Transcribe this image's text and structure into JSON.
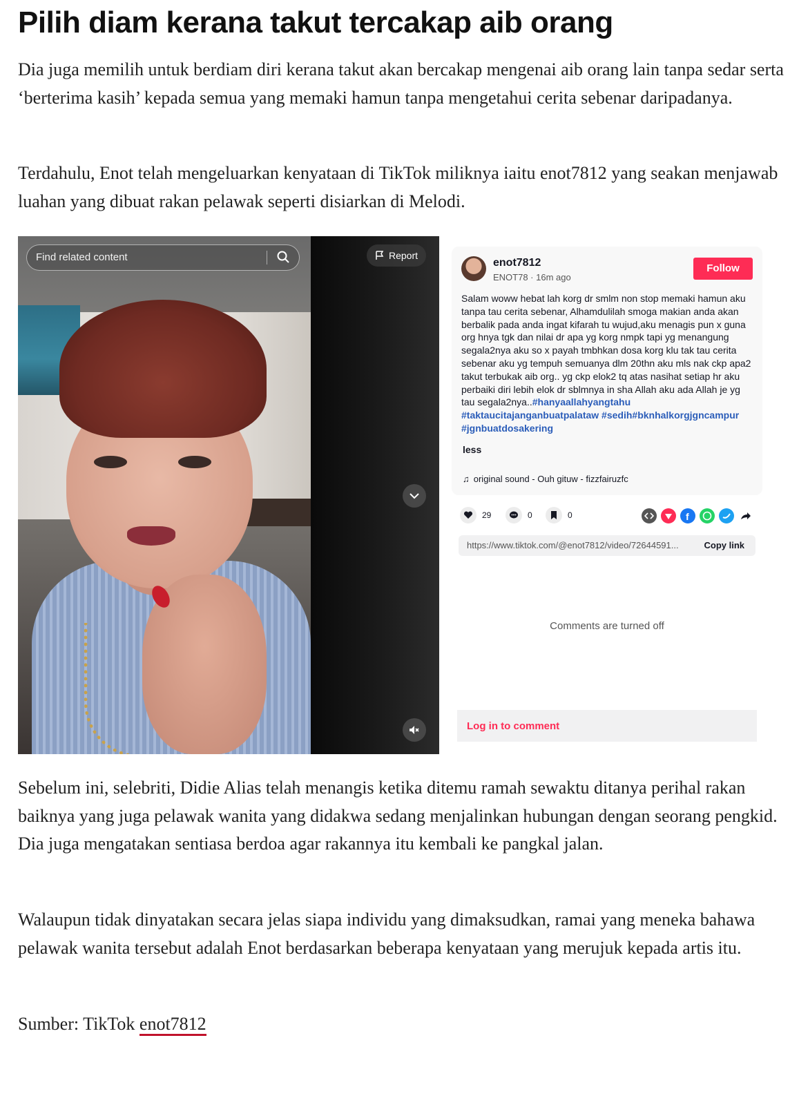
{
  "article": {
    "heading": "Pilih diam kerana takut tercakap aib orang",
    "para1": "Dia juga memilih untuk berdiam diri kerana takut akan bercakap mengenai aib orang lain tanpa sedar serta ‘berterima kasih’ kepada semua yang memaki hamun tanpa mengetahui cerita sebenar daripadanya.",
    "para2": "Terdahulu, Enot telah mengeluarkan kenyataan di TikTok miliknya iaitu enot7812 yang seakan menjawab luahan yang dibuat rakan pelawak seperti disiarkan di Melodi.",
    "para3": "Sebelum ini, selebriti, Didie Alias telah menangis ketika ditemu ramah sewaktu ditanya perihal rakan baiknya yang juga pelawak wanita yang didakwa sedang menjalinkan hubungan dengan seorang pengkid. Dia juga mengatakan sentiasa berdoa agar rakannya itu kembali ke pangkal jalan.",
    "para4": "Walaupun tidak dinyatakan secara jelas siapa individu yang dimaksudkan, ramai yang meneka bahawa pelawak wanita tersebut adalah Enot berdasarkan beberapa kenyataan yang merujuk kepada artis itu.",
    "source_prefix": "Sumber: TikTok ",
    "source_link": "enot7812"
  },
  "video": {
    "search_placeholder": "Find related content",
    "report_label": "Report",
    "icons": [
      "search-icon",
      "flag-icon",
      "chevron-down-icon",
      "mute-icon"
    ]
  },
  "tiktok": {
    "username": "enot7812",
    "handle_time": "ENOT78 · 16m ago",
    "follow_label": "Follow",
    "caption_text": "Salam woww hebat lah korg dr smlm non stop memaki hamun aku tanpa tau cerita sebenar, Alhamdulilah smoga makian anda akan berbalik pada anda ingat kifarah tu wujud,aku menagis pun x guna org hnya tgk dan nilai dr apa yg korg nmpk tapi yg menangung segala2nya aku so x payah tmbhkan dosa korg klu tak tau cerita sebenar aku yg tempuh semuanya dlm 20thn aku mls nak ckp apa2 takut terbukak aib org.. yg ckp elok2 tq atas nasihat setiap hr aku perbaiki diri lebih elok dr sblmnya in sha Allah aku ada Allah je yg tau segala2nya..",
    "caption_tags": "#hanyaallahyangtahu #taktaucitajanganbuatpalataw #sedih#bknhalkorgjgncampur #jgnbuatdosakering",
    "less_label": "less",
    "sound": "original sound - Ouh gituw - fizzfairuzfc",
    "likes": "29",
    "comments": "0",
    "saves": "0",
    "link_url": "https://www.tiktok.com/@enot7812/video/72644591...",
    "copy_label": "Copy link",
    "comments_off": "Comments are turned off",
    "login_label": "Log in to comment",
    "share_colors": [
      "#555555",
      "#fe2c55",
      "#1877f2",
      "#25d366",
      "#1da1f2"
    ]
  }
}
